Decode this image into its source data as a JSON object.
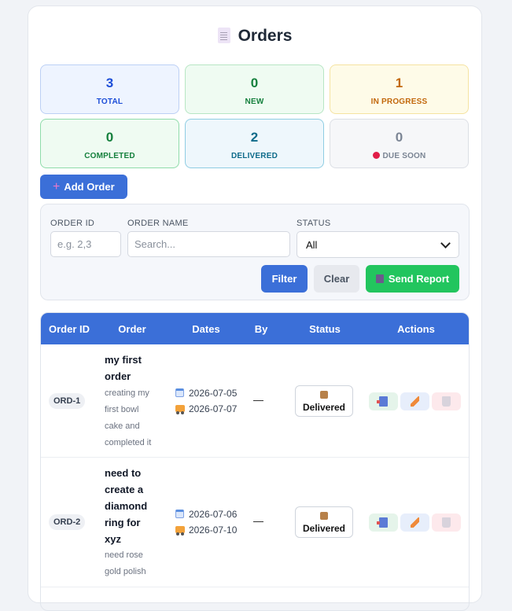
{
  "page": {
    "title": "Orders",
    "title_icon": "document-icon"
  },
  "stats": [
    {
      "value": "3",
      "label": "TOTAL",
      "color": "#1d4ed8",
      "bg": "#eef4ff",
      "border": "#bcd0f5"
    },
    {
      "value": "0",
      "label": "NEW",
      "color": "#15803d",
      "bg": "#effbf2",
      "border": "#b7e6c4"
    },
    {
      "value": "1",
      "label": "IN PROGRESS",
      "color": "#c2680c",
      "bg": "#fefbe8",
      "border": "#f5e3a1"
    },
    {
      "value": "0",
      "label": "COMPLETED",
      "color": "#15803d",
      "bg": "#effbf2",
      "border": "#8fdcaa"
    },
    {
      "value": "2",
      "label": "DELIVERED",
      "color": "#0e6b8a",
      "bg": "#eef7fc",
      "border": "#8fcde3"
    },
    {
      "value": "0",
      "label": "DUE SOON",
      "color": "#7b8594",
      "bg": "#f6f7f9",
      "border": "#dcdfe5"
    }
  ],
  "add_order": {
    "label": "Add Order"
  },
  "filters": {
    "order_id_label": "ORDER ID",
    "order_id_placeholder": "e.g. 2,3",
    "order_name_label": "ORDER NAME",
    "order_name_placeholder": "Search...",
    "status_label": "STATUS",
    "status_value": "All",
    "filter_button": "Filter",
    "clear_button": "Clear",
    "send_report_button": "Send Report"
  },
  "table": {
    "headers": [
      "Order ID",
      "Order",
      "Dates",
      "By",
      "Status",
      "Actions"
    ],
    "rows": [
      {
        "id": "ORD-1",
        "name_lines": [
          "my first",
          "order"
        ],
        "desc_lines": [
          "creating my",
          "first bowl",
          "cake and",
          "completed it"
        ],
        "start_date": "2026-07-05",
        "end_date": "2026-07-07",
        "by": "—",
        "status": "Delivered"
      },
      {
        "id": "ORD-2",
        "name_lines": [
          "need to",
          "create a",
          "diamond",
          "ring for",
          "xyz"
        ],
        "desc_lines": [
          "need rose",
          "gold polish"
        ],
        "start_date": "2026-07-06",
        "end_date": "2026-07-10",
        "by": "—",
        "status": "Delivered"
      }
    ]
  },
  "colors": {
    "primary": "#3b6fd8",
    "success": "#22c55e"
  }
}
